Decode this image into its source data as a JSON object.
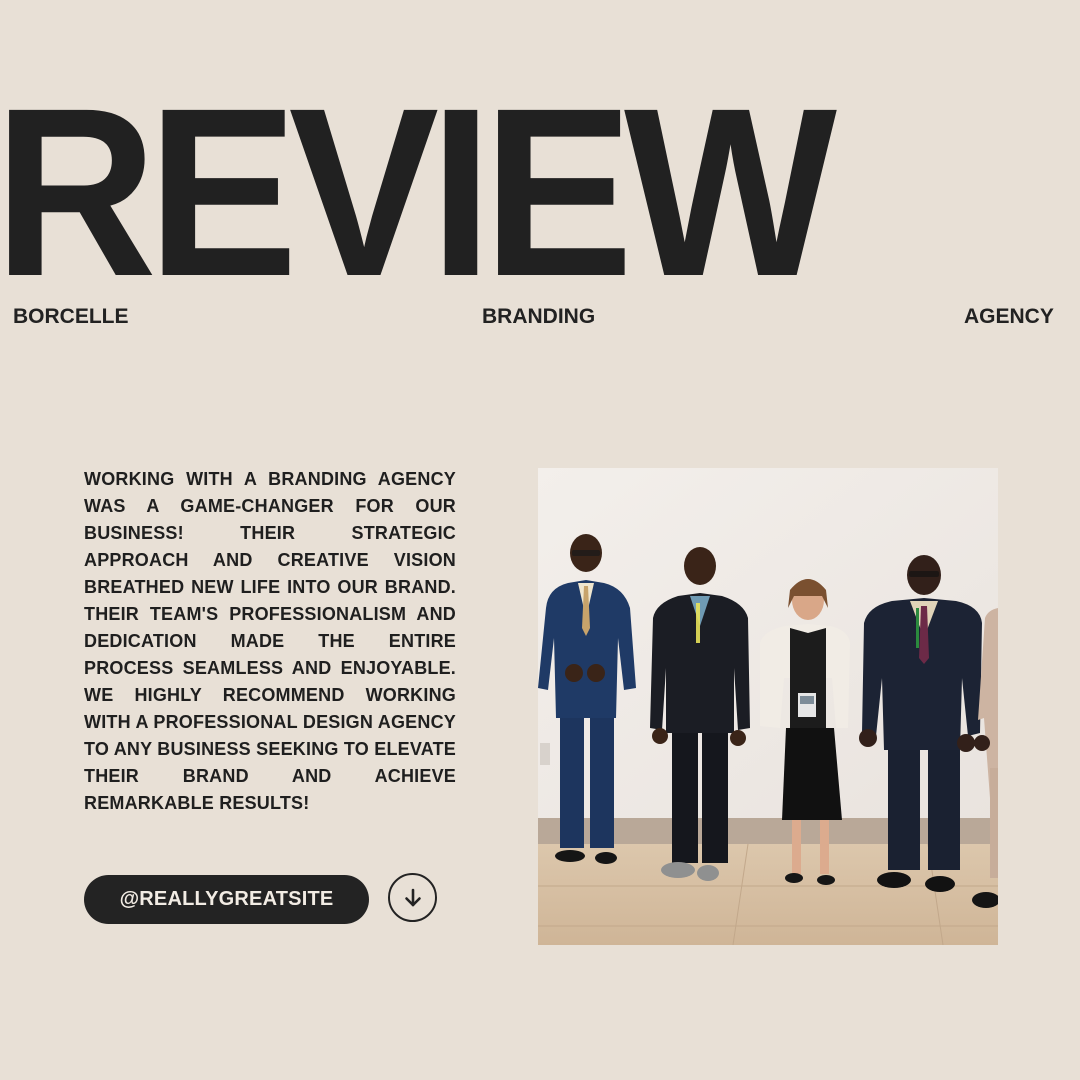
{
  "header": {
    "title": "REVIEW",
    "left_label": "BORCELLE",
    "center_label": "BRANDING",
    "right_label": "AGENCY"
  },
  "testimonial": {
    "text": "Working with a branding agency was a game-changer for our business! Their strategic approach and creative vision breathed new life into our brand. Their team's professionalism and dedication made the entire process seamless and enjoyable. We highly recommend working with a professional design agency to any business seeking to elevate their brand and achieve remarkable results!"
  },
  "footer": {
    "site_label": "@REALLYGREATSITE",
    "down_icon": "arrow-down-circle-icon"
  },
  "photo": {
    "subject": "group-photo"
  },
  "colors": {
    "background": "#e8e0d6",
    "text": "#212121",
    "pill": "#232323",
    "pill_text": "#f2ece4"
  }
}
